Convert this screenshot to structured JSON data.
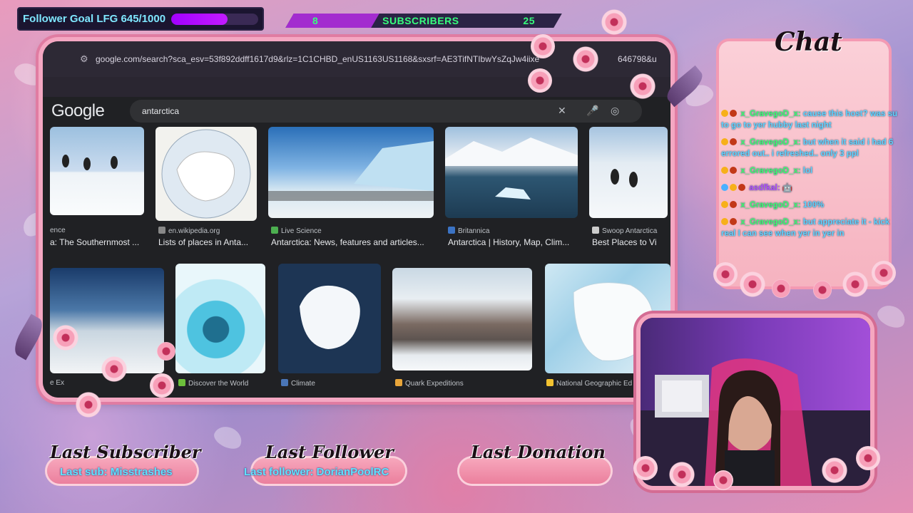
{
  "follower_goal": {
    "label": "Follower Goal LFG 645/1000",
    "current": 645,
    "target": 1000
  },
  "subscribers": {
    "current": "8",
    "label": "SUBSCRIBERS",
    "target": "25",
    "progress": 0.32
  },
  "browser": {
    "url": "google.com/search?sca_esv=53f892ddff1617d9&rlz=1C1CHBD_enUS1163US1168&sxsrf=AE3TifNTIbwYsZqJw4iixe",
    "url_tail": "646798&u",
    "logo": "Google",
    "search_value": "antarctica",
    "row1": [
      {
        "source": "ence",
        "title": "a: The Southernmost ..."
      },
      {
        "source": "en.wikipedia.org",
        "title": "Lists of places in Anta..."
      },
      {
        "source": "Live Science",
        "title": "Antarctica: News, features and articles..."
      },
      {
        "source": "Britannica",
        "title": "Antarctica | History, Map, Clim..."
      },
      {
        "source": "Swoop Antarctica",
        "title": "Best Places to Vi"
      }
    ],
    "row2": [
      {
        "source": "e Ex"
      },
      {
        "source": "Discover the World"
      },
      {
        "source": "Climate"
      },
      {
        "source": "Quark Expeditions"
      },
      {
        "source": "National Geographic Ed"
      }
    ]
  },
  "chat": {
    "title": "Chat",
    "messages": [
      {
        "user": "x_GravegoD_x:",
        "text": " cause this host? was su",
        "cont": "to go to yer hubby last night"
      },
      {
        "user": "x_GravegoD_x:",
        "text": " but when it said i had 6",
        "cont": "errored out.. i refreshed.. only 3 ppl"
      },
      {
        "user": "x_GravegoD_x:",
        "text": " lol",
        "cont": ""
      },
      {
        "user": "asdfkal:",
        "text": " 🤖",
        "cont": ""
      },
      {
        "user": "x_GravegoD_x:",
        "text": " 100%",
        "cont": ""
      },
      {
        "user": "x_GravegoD_x:",
        "text": " but appreciate it - kick",
        "cont": "real I can see when yer in yer in"
      }
    ]
  },
  "bottom": {
    "subscriber_title": "Last Subscriber",
    "subscriber_value": "Last sub: Misstrashes",
    "follower_title": "Last Follower",
    "follower_value": "Last follower: DorianPoolRC",
    "donation_title": "Last Donation",
    "donation_value": ""
  },
  "colors": {
    "accent": "#a200ff",
    "frame_pink": "#f4a7c2",
    "chat_cyan": "#5fd2ff",
    "chat_user": "#3dff71"
  }
}
